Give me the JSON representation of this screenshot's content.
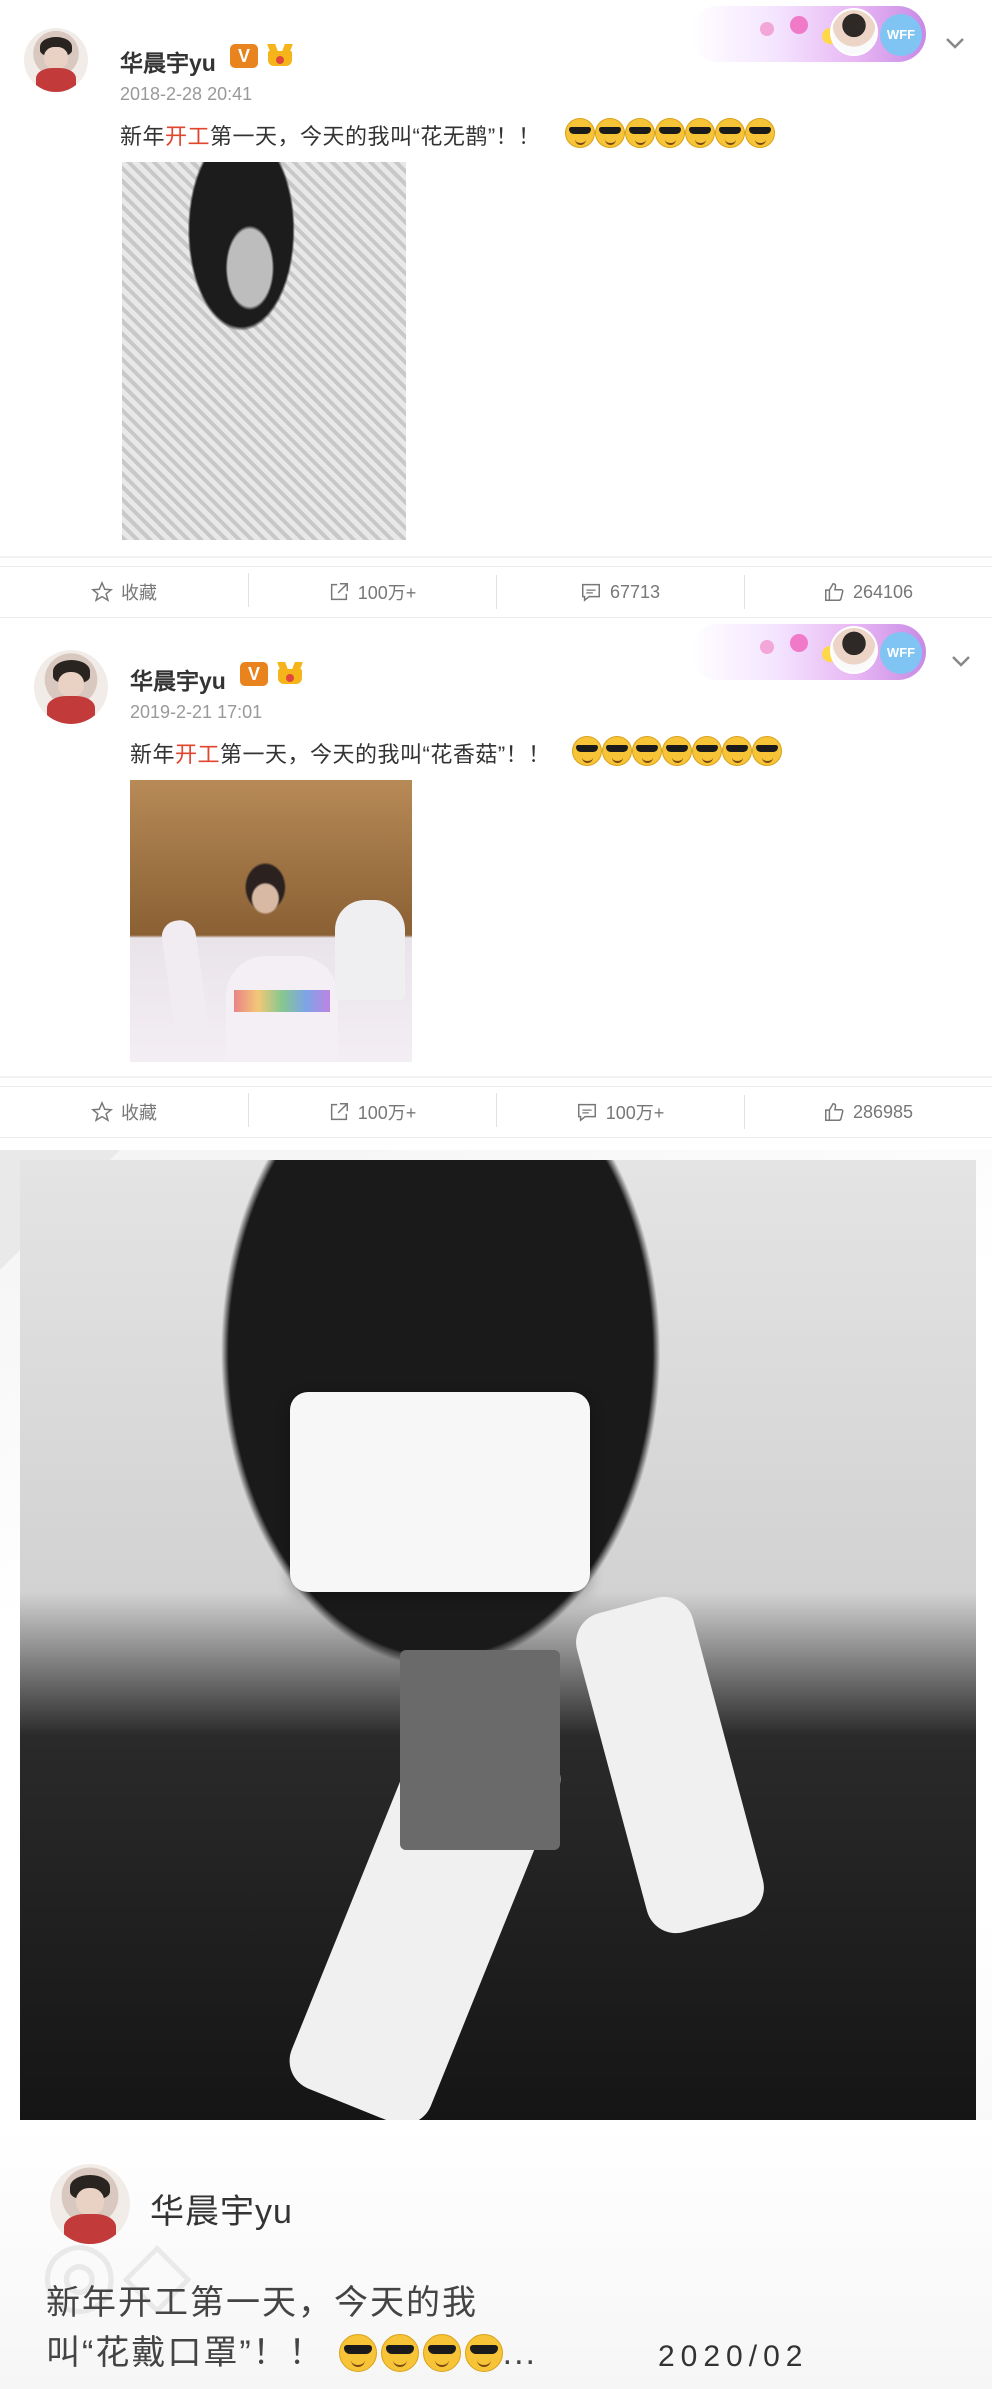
{
  "posts": [
    {
      "username": "华晨宇yu",
      "verified_badge": "V",
      "timestamp": "2018-2-28 20:41",
      "text_before": "新年",
      "text_highlight": "开工",
      "text_after": "第一天，今天的我叫“花无鹊”！！",
      "emoji_count": 7,
      "actions": [
        {
          "icon": "star-icon",
          "label": "收藏"
        },
        {
          "icon": "share-icon",
          "label": "100万+"
        },
        {
          "icon": "comment-icon",
          "label": "67713"
        },
        {
          "icon": "like-icon",
          "label": "264106"
        }
      ]
    },
    {
      "username": "华晨宇yu",
      "verified_badge": "V",
      "timestamp": "2019-2-21 17:01",
      "text_before": "新年",
      "text_highlight": "开工",
      "text_after": "第一天，今天的我叫“花香菇”！！",
      "emoji_count": 7,
      "actions": [
        {
          "icon": "star-icon",
          "label": "收藏"
        },
        {
          "icon": "share-icon",
          "label": "100万+"
        },
        {
          "icon": "comment-icon",
          "label": "100万+"
        },
        {
          "icon": "like-icon",
          "label": "286985"
        }
      ]
    }
  ],
  "banner": {
    "badge_text": "WFF"
  },
  "card": {
    "username": "华晨宇yu",
    "line1": "新年开工第一天，今天的我",
    "line2": "叫“花戴口罩”！！",
    "ellipsis": "...",
    "date": "2020/02"
  },
  "colors": {
    "highlight": "#e0452d",
    "verified": "#e8831e",
    "muted": "#999999"
  }
}
